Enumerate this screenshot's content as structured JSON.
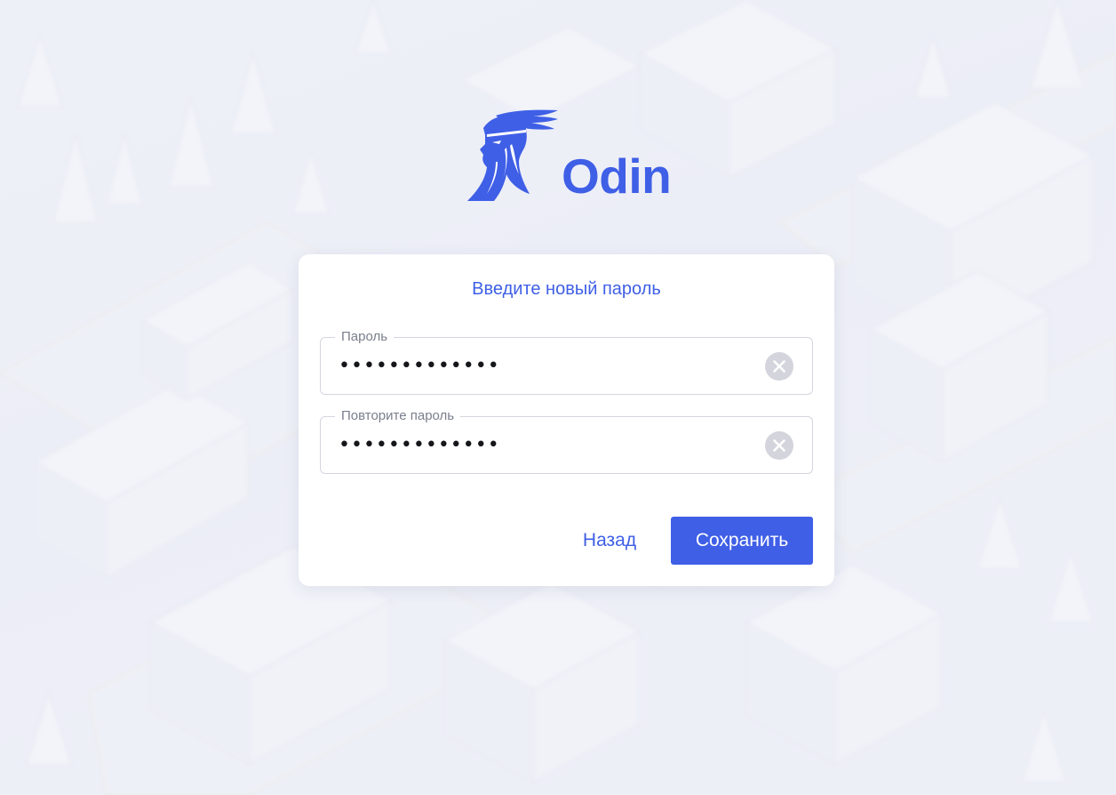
{
  "brand": {
    "name": "Odin",
    "logo_icon": "odin-viking-head-icon",
    "color": "#3f5fe6"
  },
  "form": {
    "title": "Введите новый пароль",
    "password": {
      "label": "Пароль",
      "value": "•••••••••••••"
    },
    "confirm_password": {
      "label": "Повторите пароль",
      "value": "•••••••••••••"
    },
    "clear_icon": "clear-circle-x-icon",
    "back_label": "Назад",
    "save_label": "Сохранить"
  },
  "colors": {
    "accent": "#3f5fe6",
    "background": "#eef0f7",
    "card": "#ffffff",
    "field_border": "#d4d6de",
    "clear_icon_bg": "#d4d4dc"
  }
}
